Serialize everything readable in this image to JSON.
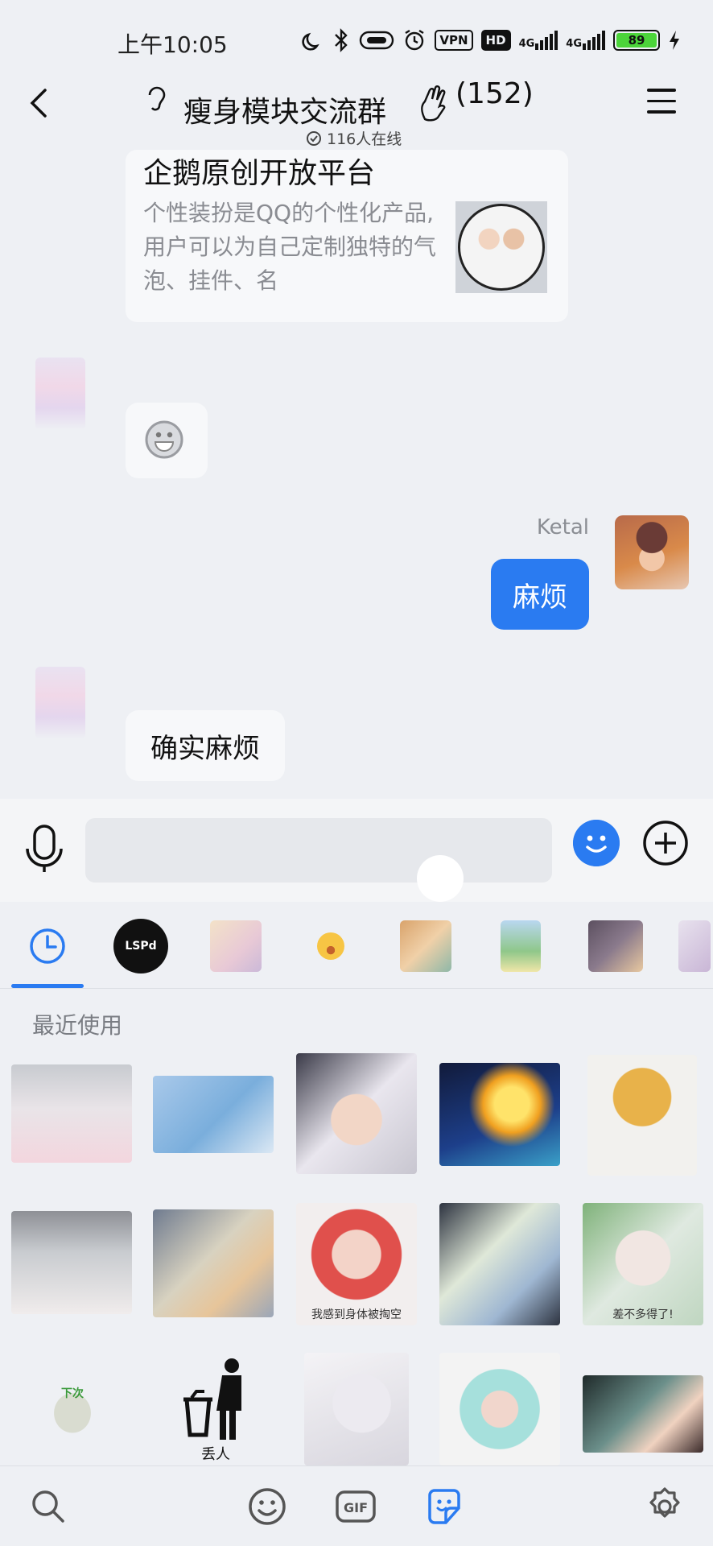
{
  "status_bar": {
    "time": "上午10:05",
    "vpn": "VPN",
    "hd": "HD",
    "net1": "4G",
    "net2": "4G",
    "battery": "89"
  },
  "header": {
    "title": "瘦身模块交流群",
    "member_count": "(152)",
    "online": "116人在线"
  },
  "card": {
    "title": "企鹅原创开放平台",
    "description": "个性装扮是QQ的个性化产品,用户可以为自己定制独特的气泡、挂件、名"
  },
  "messages": [
    {
      "sender": "",
      "type": "emoji",
      "icon": "smile-icon"
    },
    {
      "sender": "Ketal",
      "type": "text",
      "text": "麻烦"
    },
    {
      "sender": "",
      "type": "text",
      "text": "确实麻烦"
    }
  ],
  "input": {
    "placeholder": ""
  },
  "sticker_panel": {
    "section_title": "最近使用",
    "lspd_label": "LSPd",
    "sticker_captions": [
      "我感到身体被掏空",
      "差不多得了!",
      "丢人",
      "下次"
    ]
  },
  "colors": {
    "accent": "#2a7bf1",
    "background": "#eef0f4",
    "bubble_in": "#f7f8fa"
  }
}
